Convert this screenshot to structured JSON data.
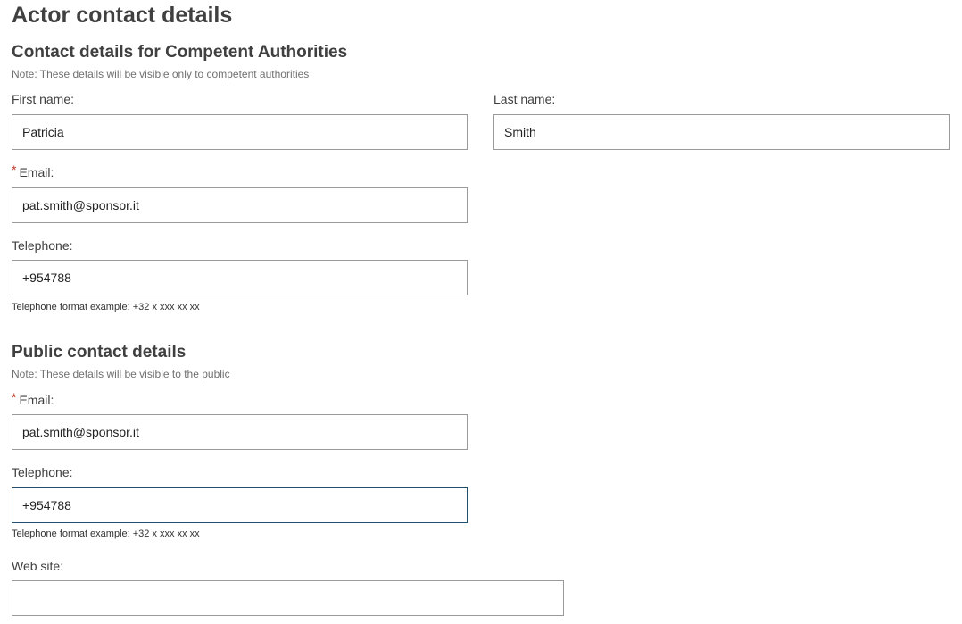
{
  "page_title": "Actor contact details",
  "competent_authorities": {
    "heading": "Contact details for Competent Authorities",
    "note": "Note: These details will be visible only to competent authorities",
    "first_name": {
      "label": "First name:",
      "value": "Patricia"
    },
    "last_name": {
      "label": "Last name:",
      "value": "Smith"
    },
    "email": {
      "required_marker": "*",
      "label": "Email:",
      "value": "pat.smith@sponsor.it"
    },
    "telephone": {
      "label": "Telephone:",
      "value": "+954788",
      "hint": "Telephone format example: +32 x xxx xx xx"
    }
  },
  "public": {
    "heading": "Public contact details",
    "note": "Note: These details will be visible to the public",
    "email": {
      "required_marker": "*",
      "label": "Email:",
      "value": "pat.smith@sponsor.it"
    },
    "telephone": {
      "label": "Telephone:",
      "value": "+954788",
      "hint": "Telephone format example: +32 x xxx xx xx",
      "focused": true
    },
    "website": {
      "label": "Web site:",
      "value": ""
    }
  },
  "colors": {
    "required": "#c0392b",
    "focus_border": "#1f4e6e",
    "field_border": "#9a9a9a"
  }
}
